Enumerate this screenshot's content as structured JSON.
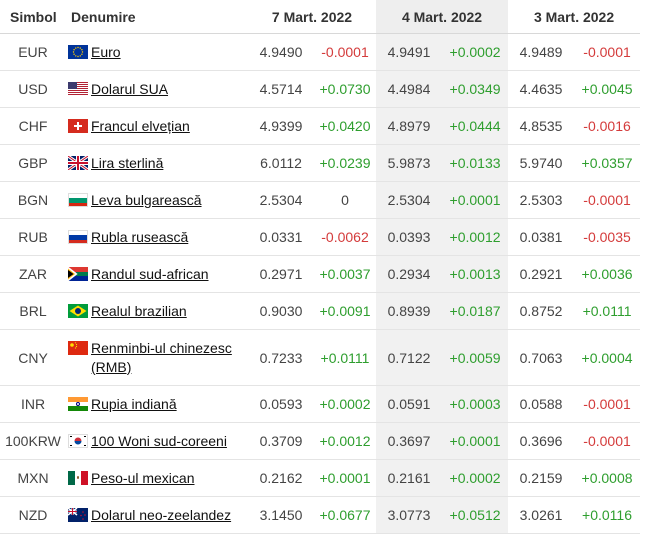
{
  "header": {
    "symbol": "Simbol",
    "name": "Denumire",
    "dates": [
      "7 Mart. 2022",
      "4 Mart. 2022",
      "3 Mart. 2022"
    ]
  },
  "colors": {
    "positive": "#2e9e2e",
    "negative": "#d43b3b",
    "shade": "#f1f1f1"
  },
  "rows": [
    {
      "symbol": "EUR",
      "name": "Euro",
      "flag": "eu-flag-icon",
      "vals": [
        "4.9490",
        "-0.0001",
        "4.9491",
        "+0.0002",
        "4.9489",
        "-0.0001"
      ]
    },
    {
      "symbol": "USD",
      "name": "Dolarul SUA",
      "flag": "us-flag-icon",
      "vals": [
        "4.5714",
        "+0.0730",
        "4.4984",
        "+0.0349",
        "4.4635",
        "+0.0045"
      ]
    },
    {
      "symbol": "CHF",
      "name": "Francul elvețian",
      "flag": "ch-flag-icon",
      "vals": [
        "4.9399",
        "+0.0420",
        "4.8979",
        "+0.0444",
        "4.8535",
        "-0.0016"
      ]
    },
    {
      "symbol": "GBP",
      "name": "Lira sterlină",
      "flag": "gb-flag-icon",
      "vals": [
        "6.0112",
        "+0.0239",
        "5.9873",
        "+0.0133",
        "5.9740",
        "+0.0357"
      ]
    },
    {
      "symbol": "BGN",
      "name": "Leva bulgarească",
      "flag": "bg-flag-icon",
      "vals": [
        "2.5304",
        "0",
        "2.5304",
        "+0.0001",
        "2.5303",
        "-0.0001"
      ]
    },
    {
      "symbol": "RUB",
      "name": "Rubla rusească",
      "flag": "ru-flag-icon",
      "vals": [
        "0.0331",
        "-0.0062",
        "0.0393",
        "+0.0012",
        "0.0381",
        "-0.0035"
      ]
    },
    {
      "symbol": "ZAR",
      "name": "Randul sud-african",
      "flag": "za-flag-icon",
      "vals": [
        "0.2971",
        "+0.0037",
        "0.2934",
        "+0.0013",
        "0.2921",
        "+0.0036"
      ]
    },
    {
      "symbol": "BRL",
      "name": "Realul brazilian",
      "flag": "br-flag-icon",
      "vals": [
        "0.9030",
        "+0.0091",
        "0.8939",
        "+0.0187",
        "0.8752",
        "+0.0111"
      ]
    },
    {
      "symbol": "CNY",
      "name": "Renminbi-ul chinezesc (RMB)",
      "flag": "cn-flag-icon",
      "vals": [
        "0.7233",
        "+0.0111",
        "0.7122",
        "+0.0059",
        "0.7063",
        "+0.0004"
      ]
    },
    {
      "symbol": "INR",
      "name": "Rupia indiană",
      "flag": "in-flag-icon",
      "vals": [
        "0.0593",
        "+0.0002",
        "0.0591",
        "+0.0003",
        "0.0588",
        "-0.0001"
      ]
    },
    {
      "symbol": "100KRW",
      "name": "100 Woni sud-coreeni",
      "flag": "kr-flag-icon",
      "vals": [
        "0.3709",
        "+0.0012",
        "0.3697",
        "+0.0001",
        "0.3696",
        "-0.0001"
      ]
    },
    {
      "symbol": "MXN",
      "name": "Peso-ul mexican",
      "flag": "mx-flag-icon",
      "vals": [
        "0.2162",
        "+0.0001",
        "0.2161",
        "+0.0002",
        "0.2159",
        "+0.0008"
      ]
    },
    {
      "symbol": "NZD",
      "name": "Dolarul neo-zeelandez",
      "flag": "nz-flag-icon",
      "vals": [
        "3.1450",
        "+0.0677",
        "3.0773",
        "+0.0512",
        "3.0261",
        "+0.0116"
      ]
    }
  ]
}
